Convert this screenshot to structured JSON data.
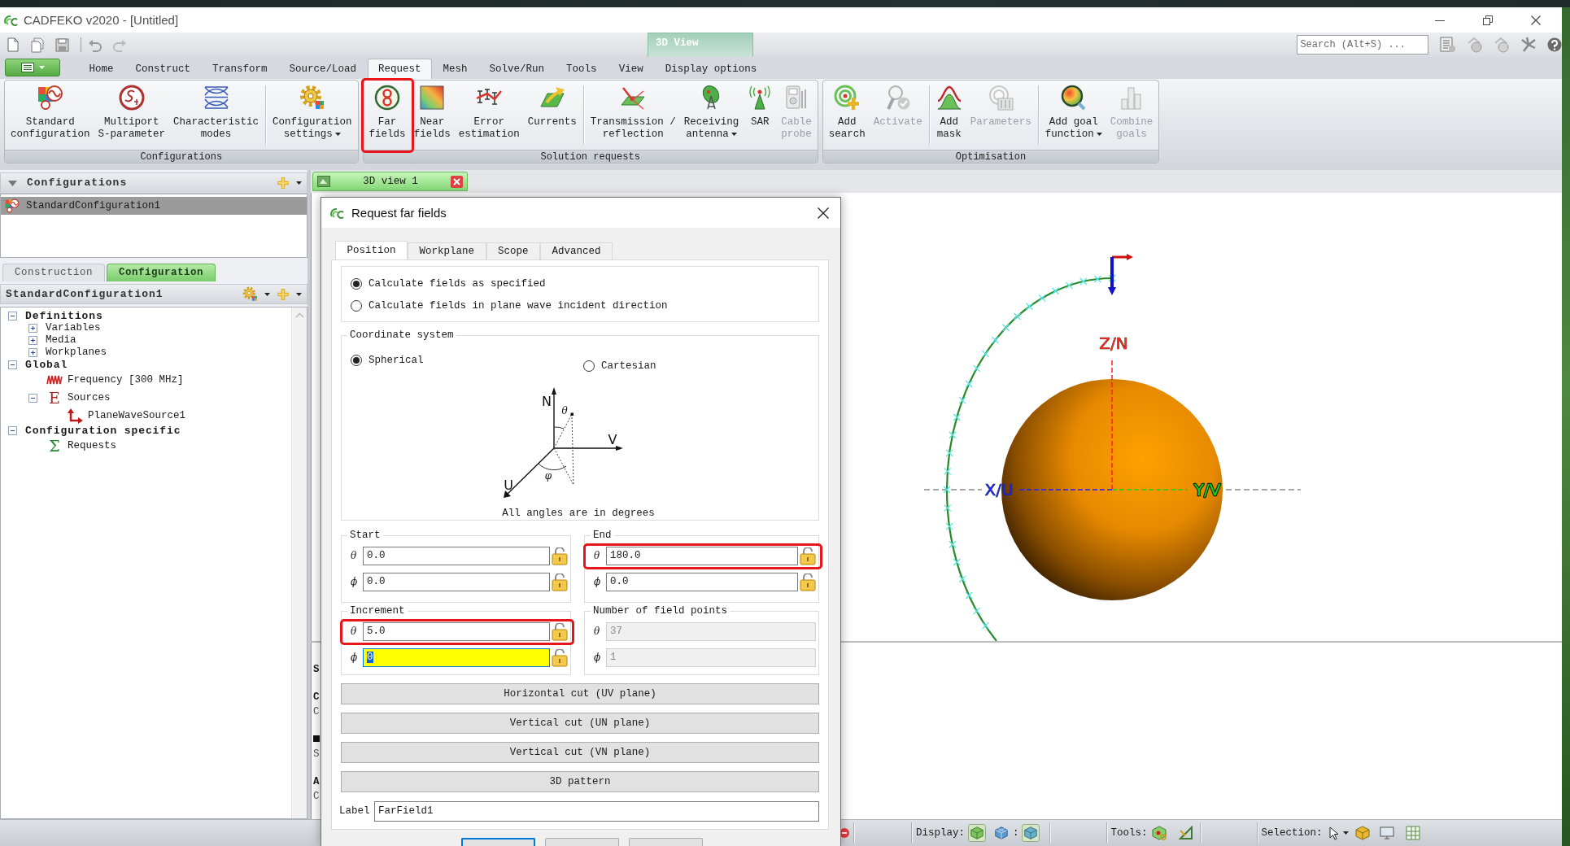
{
  "window": {
    "title": "CADFEKO v2020 - [Untitled]"
  },
  "contextual_tab": {
    "label": "3D View"
  },
  "search": {
    "placeholder": "Search (Alt+S) ..."
  },
  "ribbon": {
    "tabs": [
      {
        "label": "Home",
        "selected": false
      },
      {
        "label": "Construct",
        "selected": false
      },
      {
        "label": "Transform",
        "selected": false
      },
      {
        "label": "Source/Load",
        "selected": false
      },
      {
        "label": "Request",
        "selected": true
      },
      {
        "label": "Mesh",
        "selected": false
      },
      {
        "label": "Solve/Run",
        "selected": false
      },
      {
        "label": "Tools",
        "selected": false
      },
      {
        "label": "View",
        "selected": false
      },
      {
        "label": "Display options",
        "selected": false
      }
    ],
    "groups": [
      {
        "label": "Configurations",
        "sections": [
          [
            {
              "lines": [
                "Standard",
                "configuration"
              ],
              "disabled": false,
              "dropdown": false,
              "highlighted": false
            },
            {
              "lines": [
                "Multiport",
                "S-parameter"
              ],
              "disabled": false,
              "dropdown": false,
              "highlighted": false
            },
            {
              "lines": [
                "Characteristic",
                "modes"
              ],
              "disabled": false,
              "dropdown": false,
              "highlighted": false
            }
          ],
          [
            {
              "lines": [
                "Configuration",
                "settings"
              ],
              "disabled": false,
              "dropdown": true,
              "highlighted": false
            }
          ]
        ]
      },
      {
        "label": "Solution requests",
        "sections": [
          [
            {
              "lines": [
                "Far",
                "fields"
              ],
              "disabled": false,
              "dropdown": false,
              "highlighted": true
            },
            {
              "lines": [
                "Near",
                "fields"
              ],
              "disabled": false,
              "dropdown": false,
              "highlighted": false
            },
            {
              "lines": [
                "Error",
                "estimation"
              ],
              "disabled": false,
              "dropdown": false,
              "highlighted": false
            },
            {
              "lines": [
                "Currents"
              ],
              "disabled": false,
              "dropdown": false,
              "highlighted": false
            }
          ],
          [
            {
              "lines": [
                "Transmission /",
                "reflection"
              ],
              "disabled": false,
              "dropdown": false,
              "highlighted": false
            },
            {
              "lines": [
                "Receiving",
                "antenna"
              ],
              "disabled": false,
              "dropdown": true,
              "highlighted": false
            },
            {
              "lines": [
                "SAR"
              ],
              "disabled": false,
              "dropdown": false,
              "highlighted": false
            },
            {
              "lines": [
                "Cable",
                "probe"
              ],
              "disabled": true,
              "dropdown": false,
              "highlighted": false
            }
          ]
        ]
      },
      {
        "label": "Optimisation",
        "sections": [
          [
            {
              "lines": [
                "Add",
                "search"
              ],
              "disabled": false,
              "dropdown": false,
              "highlighted": false
            },
            {
              "lines": [
                "Activate"
              ],
              "disabled": true,
              "dropdown": false,
              "highlighted": false
            }
          ],
          [
            {
              "lines": [
                "Add",
                "mask"
              ],
              "disabled": false,
              "dropdown": false,
              "highlighted": false
            },
            {
              "lines": [
                "Parameters"
              ],
              "disabled": true,
              "dropdown": false,
              "highlighted": false
            }
          ],
          [
            {
              "lines": [
                "Add goal",
                "function"
              ],
              "disabled": false,
              "dropdown": true,
              "highlighted": false
            },
            {
              "lines": [
                "Combine",
                "goals"
              ],
              "disabled": true,
              "dropdown": false,
              "highlighted": false
            }
          ]
        ]
      }
    ]
  },
  "configurations_panel": {
    "title": "Configurations",
    "items": [
      {
        "label": "StandardConfiguration1",
        "selected": true
      }
    ]
  },
  "panel_tabs": [
    {
      "label": "Construction",
      "selected": false
    },
    {
      "label": "Configuration",
      "selected": true
    }
  ],
  "tree_panel": {
    "title": "StandardConfiguration1",
    "nodes": [
      {
        "label": "Definitions",
        "kind": "section",
        "expanded": true,
        "children": [
          {
            "label": "Variables",
            "kind": "folder",
            "expanded": false
          },
          {
            "label": "Media",
            "kind": "folder",
            "expanded": false
          },
          {
            "label": "Workplanes",
            "kind": "folder",
            "expanded": false
          }
        ]
      },
      {
        "label": "Global",
        "kind": "section",
        "expanded": true,
        "children": [
          {
            "label": "Frequency [300 MHz]",
            "kind": "frequency"
          },
          {
            "label": "Sources",
            "kind": "glyph",
            "glyph": "E",
            "color": "#b01e1e",
            "expanded": true,
            "children": [
              {
                "label": "PlaneWaveSource1",
                "kind": "source"
              }
            ]
          }
        ]
      },
      {
        "label": "Configuration specific",
        "kind": "section",
        "expanded": true,
        "children": [
          {
            "label": "Requests",
            "kind": "glyph",
            "glyph": "Σ",
            "color": "#1f8a2a"
          }
        ]
      }
    ]
  },
  "document_tabs": [
    {
      "label": "3D view 1",
      "selected": true
    }
  ],
  "view_3d": {
    "axes": [
      {
        "label": "Z/N",
        "color": "#ff2020"
      },
      {
        "label": "X/U",
        "color": "#2020ff"
      },
      {
        "label": "Y/V",
        "color": "#20d020"
      }
    ]
  },
  "output_panel": {
    "fragments": [
      {
        "kind": "heading",
        "text": "S"
      },
      {
        "kind": "heading",
        "text": "C"
      },
      {
        "kind": "line",
        "text": "C"
      },
      {
        "kind": "icon"
      },
      {
        "kind": "line",
        "text": "S"
      },
      {
        "kind": "heading",
        "text": "A"
      },
      {
        "kind": "line",
        "text": "C"
      }
    ]
  },
  "dialog": {
    "title": "Request far fields",
    "tabs": [
      {
        "label": "Position",
        "selected": true
      },
      {
        "label": "Workplane",
        "selected": false
      },
      {
        "label": "Scope",
        "selected": false
      },
      {
        "label": "Advanced",
        "selected": false
      }
    ],
    "calculation_options": [
      {
        "label": "Calculate fields as specified",
        "selected": true
      },
      {
        "label": "Calculate fields in plane wave incident direction",
        "selected": false
      }
    ],
    "coordinate_system": {
      "title": "Coordinate system",
      "options": [
        {
          "label": "Spherical",
          "selected": true
        },
        {
          "label": "Cartesian",
          "selected": false
        }
      ],
      "diagram_labels": [
        "N",
        "V",
        "U",
        "θ",
        "φ"
      ],
      "note": "All angles are in degrees"
    },
    "start": {
      "title": "Start",
      "rows": [
        {
          "symbol": "θ",
          "value": "0.0",
          "disabled": false,
          "focused": false,
          "highlighted": false
        },
        {
          "symbol": "ϕ",
          "value": "0.0",
          "disabled": false,
          "focused": false,
          "highlighted": false
        }
      ]
    },
    "end": {
      "title": "End",
      "rows": [
        {
          "symbol": "θ",
          "value": "180.0",
          "disabled": false,
          "focused": false,
          "highlighted": true
        },
        {
          "symbol": "ϕ",
          "value": "0.0",
          "disabled": false,
          "focused": false,
          "highlighted": false
        }
      ]
    },
    "increment": {
      "title": "Increment",
      "rows": [
        {
          "symbol": "θ",
          "value": "5.0",
          "disabled": false,
          "focused": false,
          "highlighted": true
        },
        {
          "symbol": "ϕ",
          "value": "0",
          "disabled": false,
          "focused": true,
          "highlighted": false
        }
      ]
    },
    "field_points": {
      "title": "Number of field points",
      "rows": [
        {
          "symbol": "θ",
          "value": "37",
          "disabled": true,
          "focused": false,
          "highlighted": false
        },
        {
          "symbol": "ϕ",
          "value": "1",
          "disabled": true,
          "focused": false,
          "highlighted": false
        }
      ]
    },
    "cut_buttons": [
      "Horizontal cut (UV plane)",
      "Vertical cut (UN plane)",
      "Vertical cut (VN plane)",
      "3D pattern"
    ],
    "label_field": {
      "label": "Label",
      "value": "FarField1"
    },
    "footer_buttons": [
      {
        "default": true
      },
      {
        "default": false
      },
      {
        "default": false
      }
    ]
  },
  "status_bar": {
    "display": {
      "label": "Display:",
      "divider": ":",
      "buttons": [
        {
          "selected": true
        },
        {
          "selected": false
        },
        {
          "selected": true
        }
      ]
    },
    "tools": {
      "label": "Tools:"
    },
    "selection": {
      "label": "Selection:"
    }
  }
}
